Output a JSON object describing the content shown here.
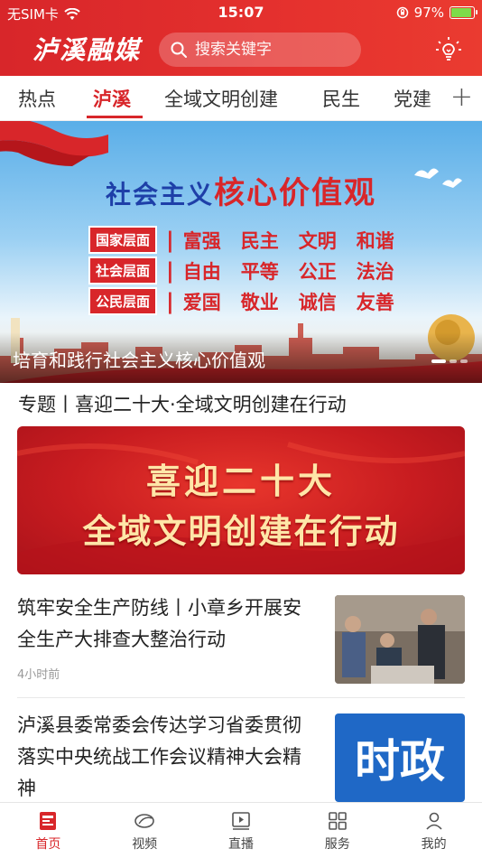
{
  "status": {
    "carrier": "无SIM卡",
    "time": "15:07",
    "battery_percent": "97%",
    "battery_level": 0.97
  },
  "header": {
    "logo": "泸溪融媒",
    "search_placeholder": "搜索关键字"
  },
  "tabs": [
    {
      "label": "热点",
      "active": false
    },
    {
      "label": "泸溪",
      "active": true
    },
    {
      "label": "全域文明创建",
      "active": false
    },
    {
      "label": "民生",
      "active": false
    },
    {
      "label": "党建",
      "active": false
    }
  ],
  "banner": {
    "headline_small": "社会主义",
    "headline_big": "核心价值观",
    "rows": [
      {
        "level": "国家层面",
        "words": [
          "富强",
          "民主",
          "文明",
          "和谐"
        ]
      },
      {
        "level": "社会层面",
        "words": [
          "自由",
          "平等",
          "公正",
          "法治"
        ]
      },
      {
        "level": "公民层面",
        "words": [
          "爱国",
          "敬业",
          "诚信",
          "友善"
        ]
      }
    ],
    "caption": "培育和践行社会主义核心价值观"
  },
  "topic": {
    "title": "专题丨喜迎二十大·全域文明创建在行动",
    "card_line1": "喜迎二十大",
    "card_line2": "全域文明创建在行动"
  },
  "news": [
    {
      "title": "筑牢安全生产防线丨小章乡开展安全生产大排查大整治行动",
      "time": "4小时前",
      "thumb": "photo"
    },
    {
      "title": "泸溪县委常委会传达学习省委贯彻落实中央统战工作会议精神大会精神",
      "thumb_text": "时政"
    }
  ],
  "bottom_nav": [
    {
      "label": "首页",
      "icon": "home-icon",
      "active": true
    },
    {
      "label": "视频",
      "icon": "video-icon",
      "active": false
    },
    {
      "label": "直播",
      "icon": "live-icon",
      "active": false
    },
    {
      "label": "服务",
      "icon": "services-icon",
      "active": false
    },
    {
      "label": "我的",
      "icon": "profile-icon",
      "active": false
    }
  ],
  "colors": {
    "brand_red": "#d8262a",
    "politics_blue": "#1f68c6"
  }
}
